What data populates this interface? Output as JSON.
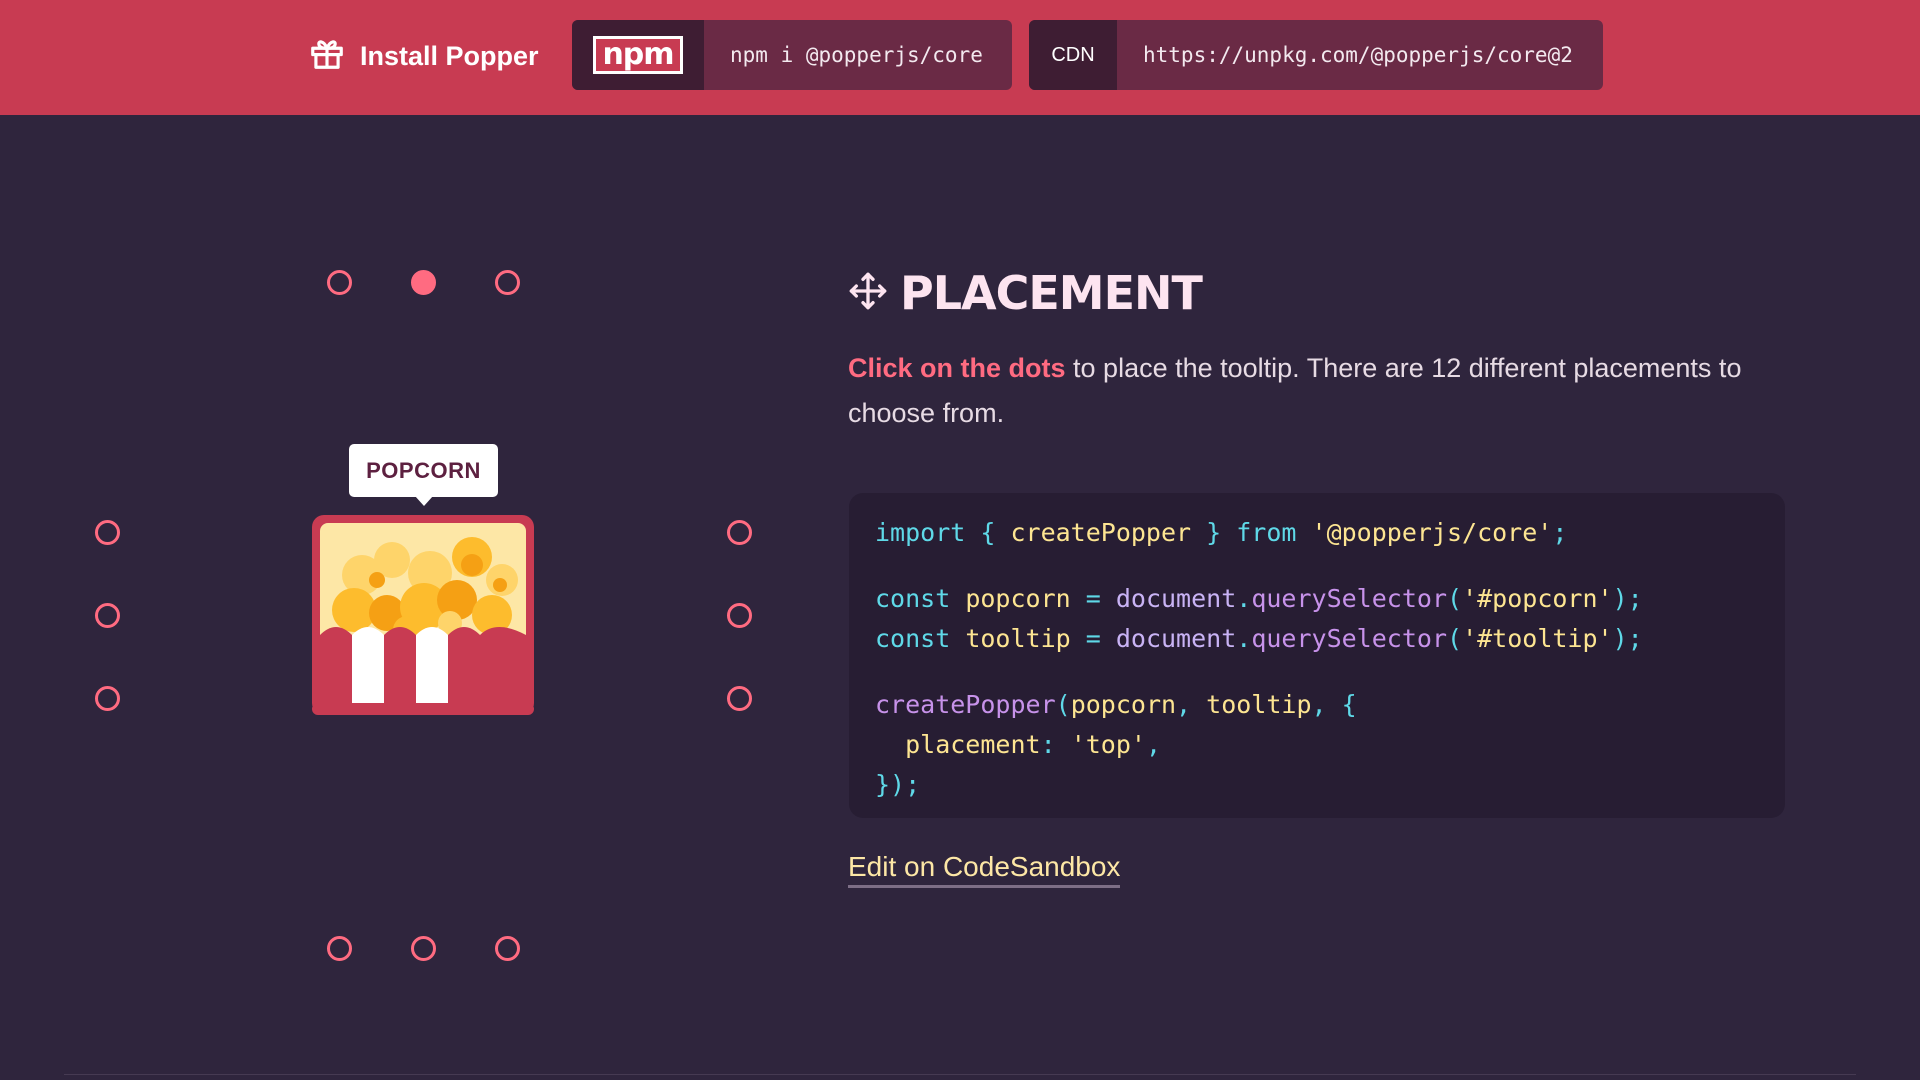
{
  "topbar": {
    "install_label": "Install Popper",
    "npm_logo": "npm",
    "npm_command": "npm i @popperjs/core",
    "cdn_label": "CDN",
    "cdn_url": "https://unpkg.com/@popperjs/core@2",
    "bg_color": "#c83b52"
  },
  "demo": {
    "tooltip_label": "POPCORN",
    "active_placement": "top",
    "dot_color": "#ff6b81"
  },
  "section": {
    "title": "PLACEMENT",
    "desc_emphasis": "Click on the dots",
    "desc_rest": " to place the tooltip. There are 12 different placements to choose from.",
    "code": {
      "line1": {
        "kw1": "import",
        "p1": " { ",
        "id1": "createPopper",
        "p2": " } ",
        "kw2": "from",
        "str1": " '@popperjs/core'",
        "p3": ";"
      },
      "line2": {
        "kw": "const",
        "id": " popcorn ",
        "op": "=",
        "obj": " document",
        "dot": ".",
        "fn": "querySelector",
        "p1": "(",
        "str": "'#popcorn'",
        "p2": ");"
      },
      "line3": {
        "kw": "const",
        "id": " tooltip ",
        "op": "=",
        "obj": " document",
        "dot": ".",
        "fn": "querySelector",
        "p1": "(",
        "str": "'#tooltip'",
        "p2": ");"
      },
      "line4": {
        "fn": "createPopper",
        "p1": "(",
        "a1": "popcorn",
        "c1": ", ",
        "a2": "tooltip",
        "c2": ", ",
        "p2": "{"
      },
      "line5": {
        "key": "  placement",
        "colon": ": ",
        "str": "'top'",
        "comma": ","
      },
      "line6": {
        "close": "});"
      }
    },
    "edit_link": "Edit on CodeSandbox"
  }
}
